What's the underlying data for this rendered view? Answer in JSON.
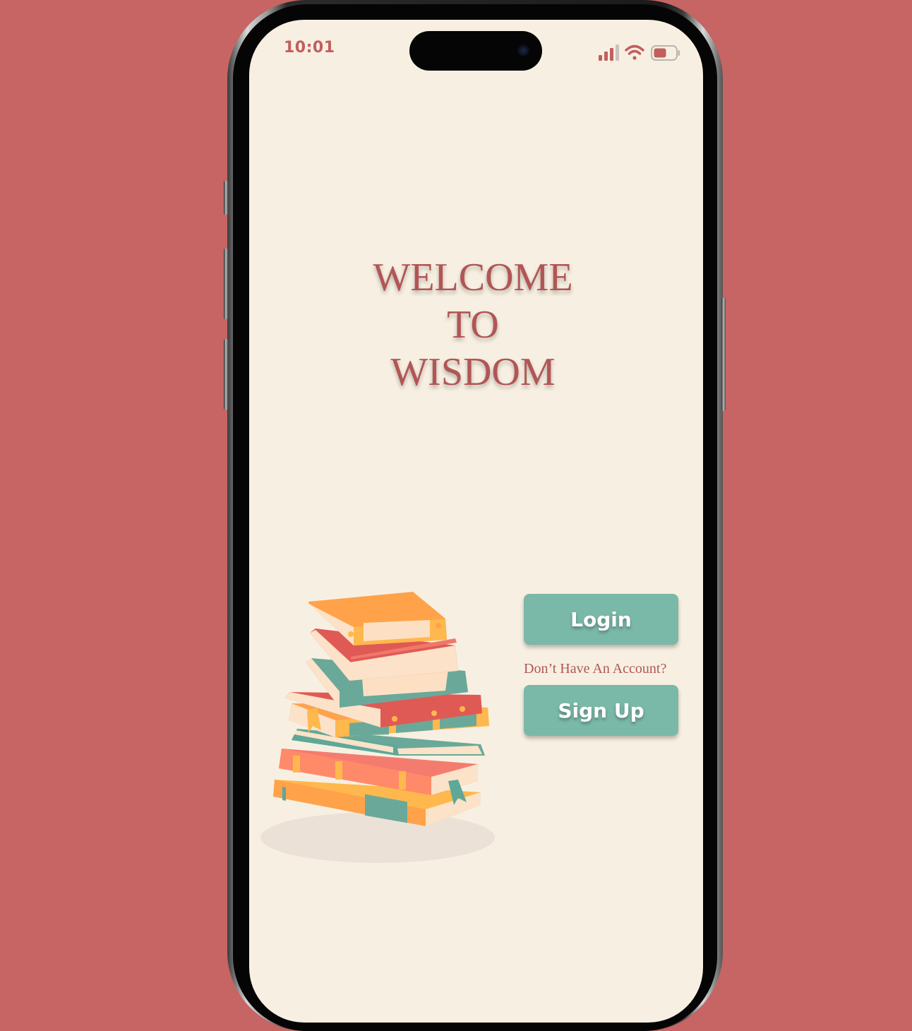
{
  "status_bar": {
    "time": "10:01",
    "signal_icon": "cellular-signal-icon",
    "wifi_icon": "wifi-icon",
    "battery_icon": "battery-icon"
  },
  "welcome": {
    "line1": "WELCOME",
    "line2": "TO",
    "line3": "WISDOM"
  },
  "illustration": {
    "icon": "book-stack-illustration"
  },
  "auth": {
    "login_label": "Login",
    "no_account_text": "Don’t Have An Account?",
    "signup_label": "Sign Up"
  },
  "colors": {
    "background": "#c76464",
    "screen": "#f7f0e2",
    "accent_text": "#b25555",
    "button": "#7ab8a8"
  }
}
